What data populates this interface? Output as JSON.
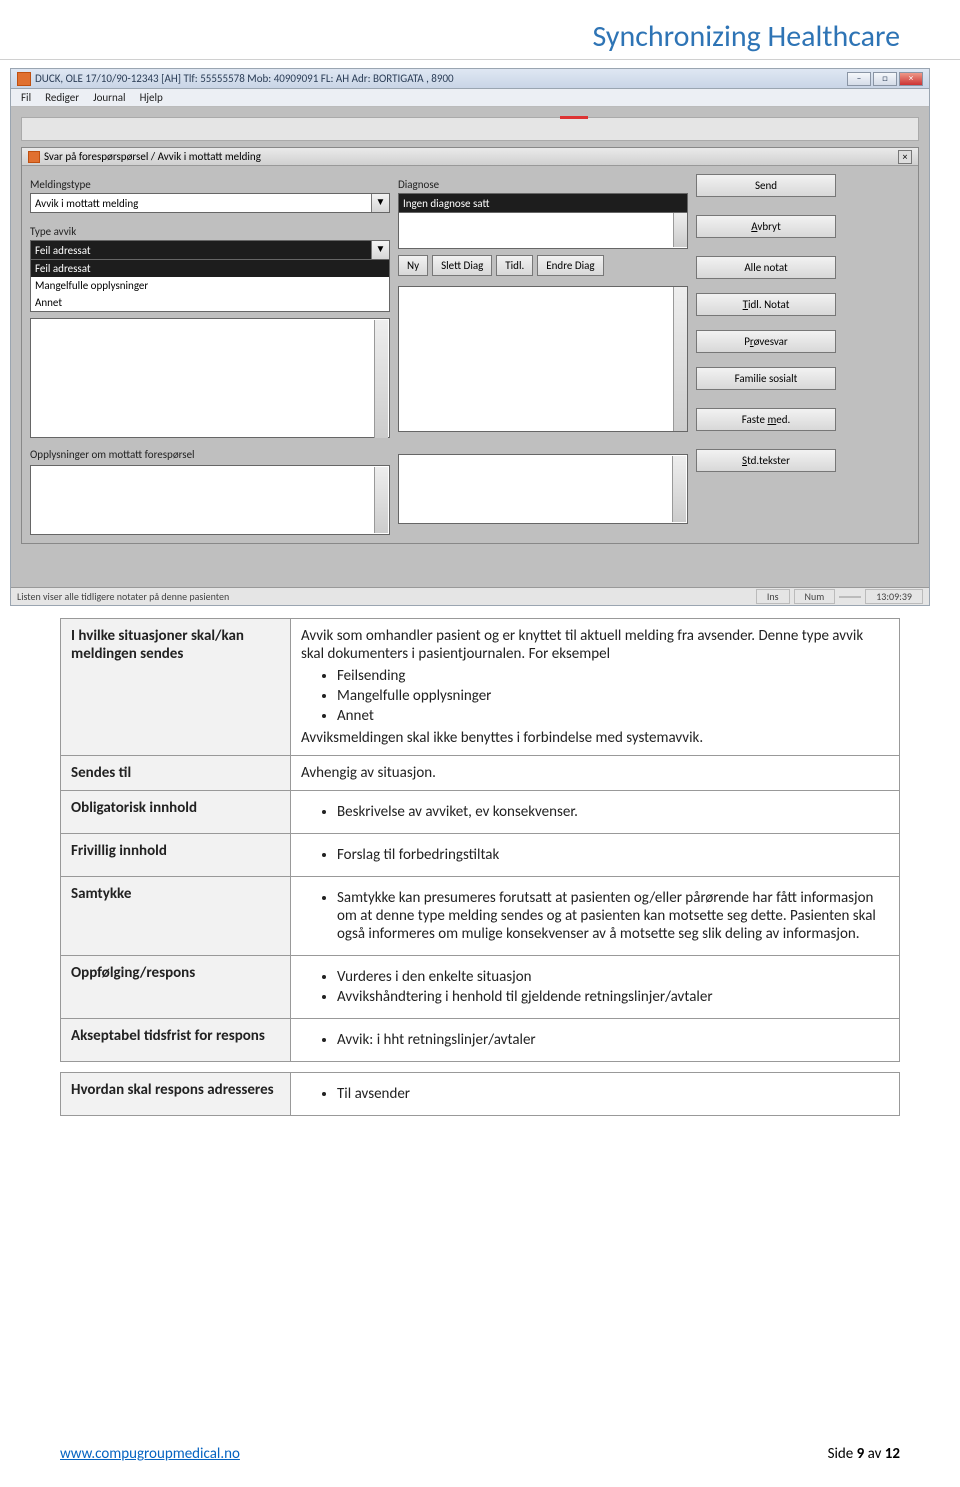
{
  "header": {
    "title": "Synchronizing Healthcare"
  },
  "screenshot": {
    "window_title": "DUCK, OLE 17/10/90-12343 [AH] Tlf: 55555578 Mob: 40909091 FL: AH Adr: BORTIGATA , 8900",
    "menu": [
      "Fil",
      "Rediger",
      "Journal",
      "Hjelp"
    ],
    "dialog_title": "Svar på forespørspørsel / Avvik i mottatt melding",
    "labels": {
      "meldingstype": "Meldingstype",
      "type_avvik": "Type avvik",
      "diagnose": "Diagnose",
      "opplysninger": "Opplysninger om mottatt forespørsel"
    },
    "meldingstype_value": "Avvik i mottatt melding",
    "diagnose_value": "Ingen diagnose satt",
    "type_avvik_value": "Feil adressat",
    "type_avvik_options": [
      "Feil adressat",
      "Mangelfulle opplysninger",
      "Annet"
    ],
    "diag_buttons": {
      "ny": "Ny",
      "slett": "Slett Diag",
      "tidl": "Tidl.",
      "endre": "Endre Diag"
    },
    "side_buttons": {
      "send": "Send",
      "avbryt": "Avbryt",
      "alle_notat": "Alle notat",
      "tidl_notat": "Tidl. Notat",
      "provesvar": "Prøvesvar",
      "familie": "Familie sosialt",
      "faste_med": "Faste med.",
      "std_tekster": "Std.tekster"
    },
    "status": {
      "text": "Listen viser alle tidligere notater på denne pasienten",
      "ins": "Ins",
      "num": "Num",
      "time": "13:09:39"
    }
  },
  "table": {
    "rows": [
      {
        "label": "I hvilke situasjoner skal/kan meldingen sendes",
        "intro": "Avvik som omhandler pasient og er knyttet til aktuell melding fra avsender. Denne type avvik skal dokumenters i pasientjournalen. For eksempel",
        "bullets": [
          "Feilsending",
          "Mangelfulle opplysninger",
          "Annet"
        ],
        "outro": "Avviksmeldingen skal ikke benyttes i forbindelse med systemavvik."
      },
      {
        "label": "Sendes til",
        "text": "Avhengig av situasjon."
      },
      {
        "label": "Obligatorisk innhold",
        "bullets": [
          "Beskrivelse av avviket, ev konsekvenser."
        ]
      },
      {
        "label": "Frivillig innhold",
        "bullets": [
          "Forslag til forbedringstiltak"
        ]
      },
      {
        "label": "Samtykke",
        "bullets": [
          "Samtykke kan presumeres forutsatt at pasienten og/eller pårørende har fått informasjon om at denne type melding sendes og at pasienten kan motsette seg dette. Pasienten skal også informeres om mulige konsekvenser av å motsette seg slik deling av informasjon."
        ]
      },
      {
        "label": "Oppfølging/respons",
        "bullets": [
          "Vurderes i den enkelte situasjon",
          "Avvikshåndtering i henhold til gjeldende retningslinjer/avtaler"
        ]
      },
      {
        "label": "Akseptabel tidsfrist for respons",
        "bullets": [
          "Avvik: i hht retningslinjer/avtaler"
        ]
      }
    ],
    "last_row": {
      "label": "Hvordan skal respons adresseres",
      "bullets": [
        "Til avsender"
      ]
    }
  },
  "footer": {
    "url": "www.compugroupmedical.no",
    "page_prefix": "Side ",
    "page_num": "9",
    "page_mid": " av ",
    "page_total": "12"
  }
}
